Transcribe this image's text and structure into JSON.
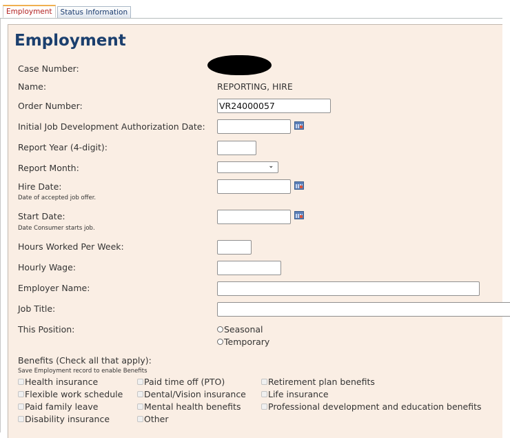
{
  "tabs": [
    {
      "label": "Employment",
      "active": true
    },
    {
      "label": "Status Information",
      "active": false
    }
  ],
  "page_title": "Employment",
  "fields": {
    "case_number": {
      "label": "Case Number:",
      "value_redacted": true
    },
    "name": {
      "label": "Name:",
      "value": "REPORTING, HIRE"
    },
    "order_number": {
      "label": "Order Number:",
      "value": "VR24000057"
    },
    "initial_job_dev_auth_date": {
      "label": "Initial Job Development Authorization Date:",
      "value": ""
    },
    "report_year": {
      "label": "Report Year (4-digit):",
      "value": ""
    },
    "report_month": {
      "label": "Report Month:",
      "selected": ""
    },
    "hire_date": {
      "label": "Hire Date:",
      "hint": "Date of accepted job offer.",
      "value": ""
    },
    "start_date": {
      "label": "Start Date:",
      "hint": "Date Consumer starts job.",
      "value": ""
    },
    "hours_per_week": {
      "label": "Hours Worked Per Week:",
      "value": ""
    },
    "hourly_wage": {
      "label": "Hourly Wage:",
      "value": ""
    },
    "employer_name": {
      "label": "Employer Name:",
      "value": ""
    },
    "job_title": {
      "label": "Job Title:",
      "value": ""
    },
    "this_position": {
      "label": "This Position:",
      "options": [
        "Seasonal",
        "Temporary"
      ],
      "selected": null
    }
  },
  "benefits": {
    "label": "Benefits (Check all that apply):",
    "hint": "Save Employment record to enable Benefits",
    "items": [
      {
        "label": "Health insurance",
        "checked": false,
        "enabled": false
      },
      {
        "label": "Paid time off (PTO)",
        "checked": false,
        "enabled": false
      },
      {
        "label": "Retirement plan benefits",
        "checked": false,
        "enabled": false
      },
      {
        "label": "Flexible work schedule",
        "checked": false,
        "enabled": false
      },
      {
        "label": "Dental/Vision insurance",
        "checked": false,
        "enabled": false
      },
      {
        "label": "Life insurance",
        "checked": false,
        "enabled": false
      },
      {
        "label": "Paid family leave",
        "checked": false,
        "enabled": false
      },
      {
        "label": "Mental health benefits",
        "checked": false,
        "enabled": false
      },
      {
        "label": "Professional development and education benefits",
        "checked": false,
        "enabled": false
      },
      {
        "label": "Disability insurance",
        "checked": false,
        "enabled": false
      },
      {
        "label": "Other",
        "checked": false,
        "enabled": false
      }
    ]
  },
  "icons": {
    "calendar": "calendar-icon",
    "dropdown": "chevron-down-icon"
  },
  "colors": {
    "title": "#1b3f6e",
    "panel_bg": "#faeee4",
    "active_tab_text": "#b22222"
  }
}
